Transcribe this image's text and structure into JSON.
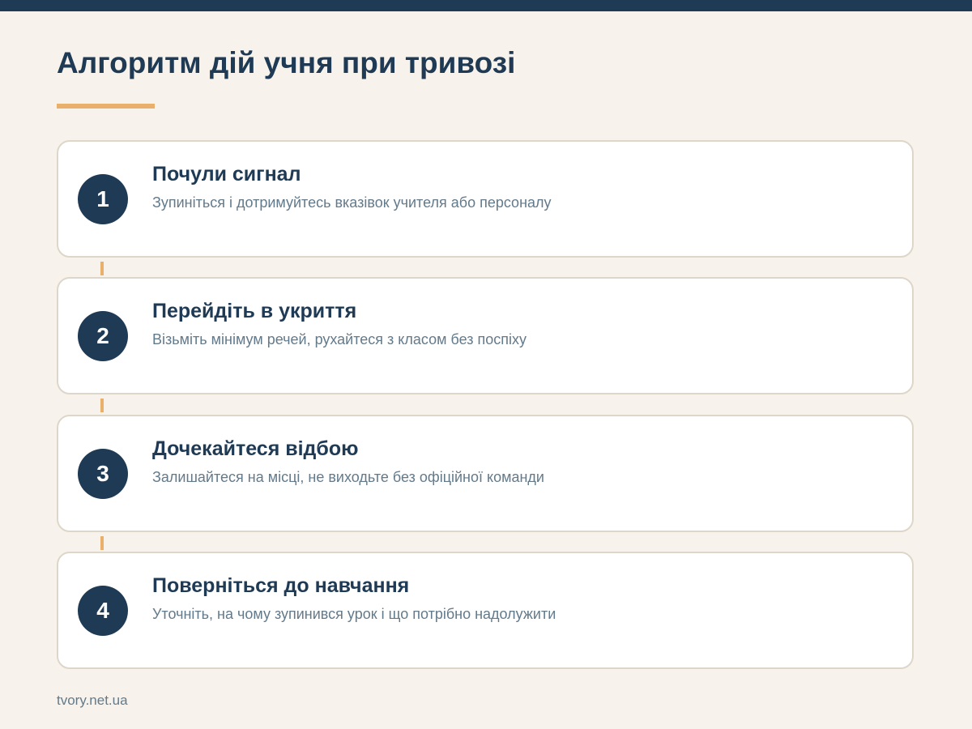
{
  "title": "Алгоритм дій учня при тривозі",
  "steps": [
    {
      "number": "1",
      "title": "Почули сигнал",
      "description": "Зупиніться і дотримуйтесь вказівок учителя або персоналу"
    },
    {
      "number": "2",
      "title": "Перейдіть в укриття",
      "description": "Візьміть мінімум речей, рухайтеся з класом без поспіху"
    },
    {
      "number": "3",
      "title": "Дочекайтеся відбою",
      "description": "Залишайтеся на місці, не виходьте без офіційної команди"
    },
    {
      "number": "4",
      "title": "Поверніться до навчання",
      "description": "Уточніть, на чому зупинився урок і що потрібно надолужити"
    }
  ],
  "footer": {
    "source": "tvory.net.ua"
  },
  "colors": {
    "primary": "#1f3a54",
    "accent": "#e8b06a",
    "background": "#f7f3ec",
    "muted_text": "#637a8b",
    "card_border": "#ddd6c9"
  }
}
